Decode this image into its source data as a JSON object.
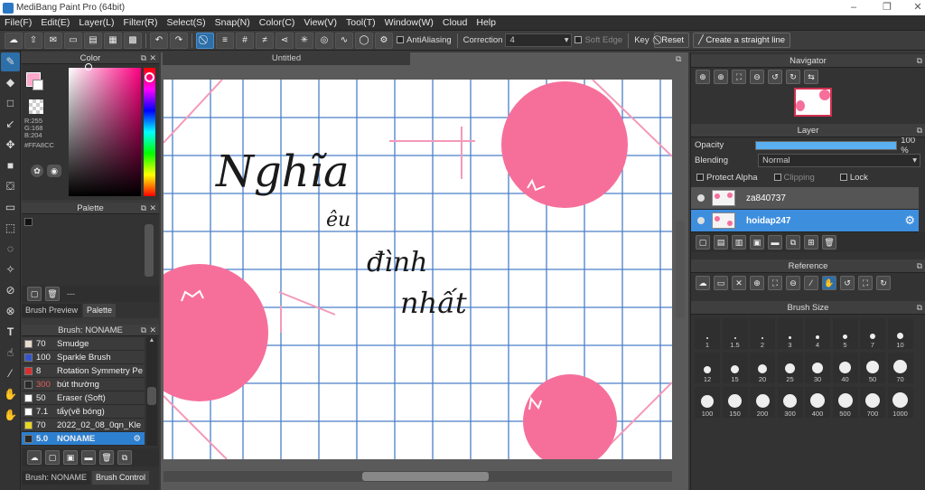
{
  "app": {
    "title": "MediBang Paint Pro (64bit)"
  },
  "menu": [
    "File(F)",
    "Edit(E)",
    "Layer(L)",
    "Filter(R)",
    "Select(S)",
    "Snap(N)",
    "Color(C)",
    "View(V)",
    "Tool(T)",
    "Window(W)",
    "Cloud",
    "Help"
  ],
  "toolbar": {
    "antialias": "AntiAliasing",
    "correction_label": "Correction",
    "correction_value": "4",
    "soft_edge": "Soft Edge",
    "key": "Key",
    "reset": "Reset",
    "straight": "Create a straight line"
  },
  "color": {
    "title": "Color",
    "r": "R:255",
    "g": "G:168",
    "b": "B:204",
    "hex": "#FFA8CC",
    "primary": "#FFA8CC"
  },
  "palette": {
    "title": "Palette",
    "dash": "---",
    "tab1": "Brush Preview",
    "tab2": "Palette"
  },
  "brush": {
    "title": "Brush: NONAME",
    "tab1": "Brush: NONAME",
    "tab2": "Brush Control",
    "items": [
      {
        "size": "70",
        "name": "Smudge",
        "color": "#e8dccd"
      },
      {
        "size": "100",
        "name": "Sparkle Brush",
        "color": "#3355cc"
      },
      {
        "size": "8",
        "name": "Rotation Symmetry Pe",
        "color": "#d83030"
      },
      {
        "size": "300",
        "name": "bút thường",
        "color": "#2a2a2a"
      },
      {
        "size": "50",
        "name": "Eraser (Soft)",
        "color": "#ffffff"
      },
      {
        "size": "7.1",
        "name": "tẩy(vẽ bóng)",
        "color": "#ffffff"
      },
      {
        "size": "70",
        "name": "2022_02_08_0qn_Kle",
        "color": "#e8d820"
      },
      {
        "size": "5.0",
        "name": "NONAME",
        "color": "#2a2a2a"
      }
    ]
  },
  "canvas": {
    "tab": "Untitled",
    "text1": "Nghĩa",
    "text2": "êu",
    "text3": "đình",
    "text4": "nhất"
  },
  "navigator": {
    "title": "Navigator"
  },
  "layer": {
    "title": "Layer",
    "opacity_label": "Opacity",
    "opacity_value": "100 %",
    "opacity": 1.0,
    "blending_label": "Blending",
    "blending_value": "Normal",
    "protect_alpha": "Protect Alpha",
    "clipping": "Clipping",
    "lock": "Lock",
    "layers": [
      "za840737",
      "hoidap247"
    ]
  },
  "reference": {
    "title": "Reference"
  },
  "brushsize": {
    "title": "Brush Size",
    "sizes": [
      "1",
      "1.5",
      "2",
      "3",
      "4",
      "5",
      "7",
      "10",
      "12",
      "15",
      "20",
      "25",
      "30",
      "40",
      "50",
      "70",
      "100",
      "150",
      "200",
      "300",
      "400",
      "500",
      "700",
      "1000"
    ]
  }
}
